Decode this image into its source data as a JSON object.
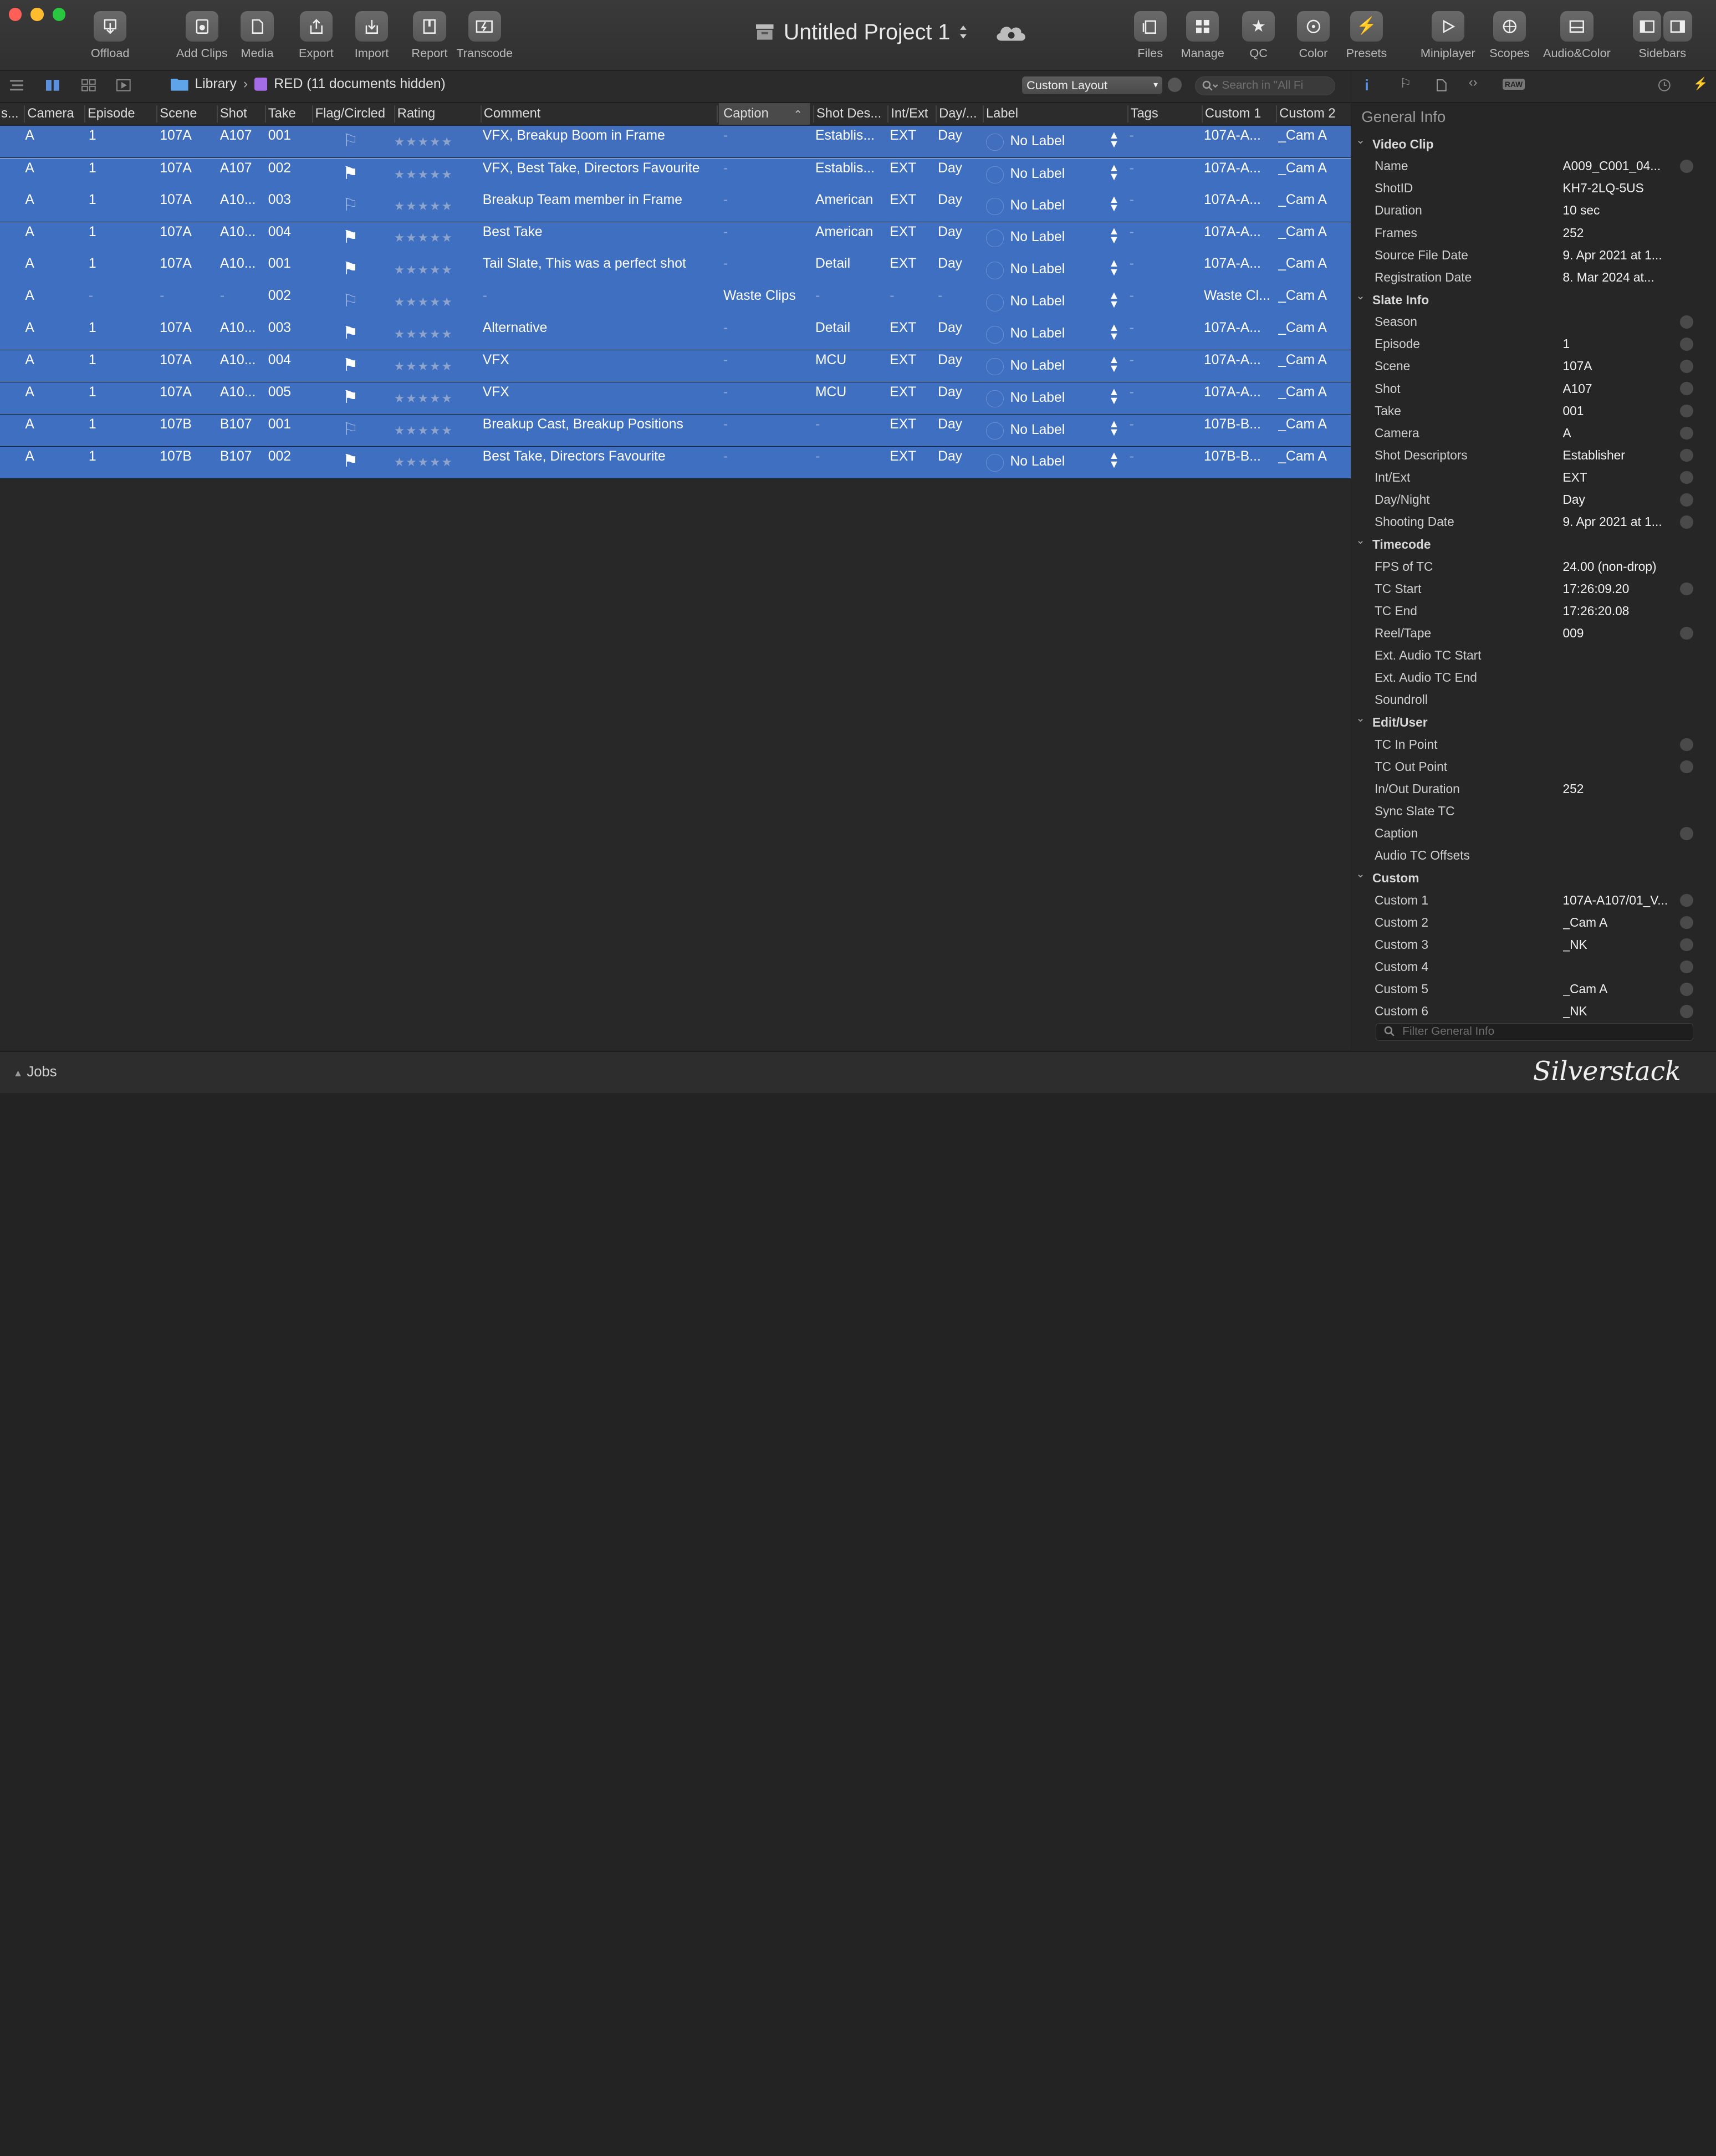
{
  "toolbar": {
    "buttons": [
      {
        "label": "Offload",
        "icon": "offload-icon"
      },
      {
        "label": "Add Clips",
        "icon": "add-clips-icon"
      },
      {
        "label": "Media",
        "icon": "media-icon"
      },
      {
        "label": "Export",
        "icon": "export-icon"
      },
      {
        "label": "Import",
        "icon": "import-icon"
      },
      {
        "label": "Report",
        "icon": "report-icon"
      },
      {
        "label": "Transcode",
        "icon": "transcode-icon"
      }
    ],
    "right_buttons": [
      {
        "label": "Files",
        "icon": "files-icon"
      },
      {
        "label": "Manage",
        "icon": "manage-icon"
      },
      {
        "label": "QC",
        "icon": "star-icon"
      },
      {
        "label": "Color",
        "icon": "color-icon"
      },
      {
        "label": "Presets",
        "icon": "bolt-icon"
      },
      {
        "label": "Miniplayer",
        "icon": "play-icon"
      },
      {
        "label": "Scopes",
        "icon": "scopes-icon"
      },
      {
        "label": "Audio&Color",
        "icon": "audio-color-icon"
      },
      {
        "label": "Sidebars",
        "icon": "sidebars-icon"
      }
    ],
    "project_title": "Untitled Project 1"
  },
  "subbar": {
    "breadcrumb_library": "Library",
    "breadcrumb_separator": "›",
    "breadcrumb_current": "RED (11 documents hidden)",
    "layout_select": "Custom Layout",
    "search_placeholder": "Search in \"All Fi"
  },
  "table": {
    "headers": [
      "s...",
      "Camera",
      "Episode",
      "Scene",
      "Shot",
      "Take",
      "Flag/Circled",
      "Rating",
      "Comment",
      "Caption",
      "Shot Des...",
      "Int/Ext",
      "Day/...",
      "Label",
      "Tags",
      "Custom 1",
      "Custom 2"
    ],
    "rows": [
      {
        "camera": "A",
        "episode": "1",
        "scene": "107A",
        "shot": "A107",
        "take": "001",
        "comment": "VFX, Breakup Boom in Frame",
        "caption": "-",
        "shotdesc": "Establis...",
        "intext": "EXT",
        "day": "Day",
        "label": "No Label",
        "tags": "-",
        "c1": "107A-A...",
        "c2": "_Cam A"
      },
      {
        "camera": "A",
        "episode": "1",
        "scene": "107A",
        "shot": "A107",
        "take": "002",
        "comment": "VFX, Best Take, Directors Favourite",
        "caption": "-",
        "shotdesc": "Establis...",
        "intext": "EXT",
        "day": "Day",
        "label": "No Label",
        "tags": "-",
        "c1": "107A-A...",
        "c2": "_Cam A"
      },
      {
        "camera": "A",
        "episode": "1",
        "scene": "107A",
        "shot": "A10...",
        "take": "003",
        "comment": "Breakup Team member in Frame",
        "caption": "-",
        "shotdesc": "American",
        "intext": "EXT",
        "day": "Day",
        "label": "No Label",
        "tags": "-",
        "c1": "107A-A...",
        "c2": "_Cam A"
      },
      {
        "camera": "A",
        "episode": "1",
        "scene": "107A",
        "shot": "A10...",
        "take": "004",
        "comment": "Best Take",
        "caption": "-",
        "shotdesc": "American",
        "intext": "EXT",
        "day": "Day",
        "label": "No Label",
        "tags": "-",
        "c1": "107A-A...",
        "c2": "_Cam A"
      },
      {
        "camera": "A",
        "episode": "1",
        "scene": "107A",
        "shot": "A10...",
        "take": "001",
        "comment": "Tail Slate, This was a perfect shot",
        "caption": "-",
        "shotdesc": "Detail",
        "intext": "EXT",
        "day": "Day",
        "label": "No Label",
        "tags": "-",
        "c1": "107A-A...",
        "c2": "_Cam A"
      },
      {
        "camera": "A",
        "episode": "-",
        "scene": "-",
        "shot": "-",
        "take": "002",
        "comment": "-",
        "caption": "Waste Clips",
        "shotdesc": "-",
        "intext": "-",
        "day": "-",
        "label": "No Label",
        "tags": "-",
        "c1": "Waste Cl...",
        "c2": "_Cam A"
      },
      {
        "camera": "A",
        "episode": "1",
        "scene": "107A",
        "shot": "A10...",
        "take": "003",
        "comment": "Alternative",
        "caption": "-",
        "shotdesc": "Detail",
        "intext": "EXT",
        "day": "Day",
        "label": "No Label",
        "tags": "-",
        "c1": "107A-A...",
        "c2": "_Cam A"
      },
      {
        "camera": "A",
        "episode": "1",
        "scene": "107A",
        "shot": "A10...",
        "take": "004",
        "comment": "VFX",
        "caption": "-",
        "shotdesc": "MCU",
        "intext": "EXT",
        "day": "Day",
        "label": "No Label",
        "tags": "-",
        "c1": "107A-A...",
        "c2": "_Cam A"
      },
      {
        "camera": "A",
        "episode": "1",
        "scene": "107A",
        "shot": "A10...",
        "take": "005",
        "comment": "VFX",
        "caption": "-",
        "shotdesc": "MCU",
        "intext": "EXT",
        "day": "Day",
        "label": "No Label",
        "tags": "-",
        "c1": "107A-A...",
        "c2": "_Cam A"
      },
      {
        "camera": "A",
        "episode": "1",
        "scene": "107B",
        "shot": "B107",
        "take": "001",
        "comment": "Breakup Cast, Breakup Positions",
        "caption": "-",
        "shotdesc": "-",
        "intext": "EXT",
        "day": "Day",
        "label": "No Label",
        "tags": "-",
        "c1": "107B-B...",
        "c2": "_Cam A"
      },
      {
        "camera": "A",
        "episode": "1",
        "scene": "107B",
        "shot": "B107",
        "take": "002",
        "comment": "Best Take, Directors Favourite",
        "caption": "-",
        "shotdesc": "-",
        "intext": "EXT",
        "day": "Day",
        "label": "No Label",
        "tags": "-",
        "c1": "107B-B...",
        "c2": "_Cam A"
      }
    ],
    "rating_stars": "★★★★★"
  },
  "inspector": {
    "title": "General Info",
    "sections": [
      {
        "name": "Video Clip",
        "items": [
          {
            "k": "Name",
            "v": "A009_C001_04...",
            "e": true
          },
          {
            "k": "ShotID",
            "v": "KH7-2LQ-5US",
            "e": false
          },
          {
            "k": "Duration",
            "v": "10 sec",
            "e": false
          },
          {
            "k": "Frames",
            "v": "252",
            "e": false
          },
          {
            "k": "Source File Date",
            "v": "9. Apr 2021 at 1...",
            "e": false
          },
          {
            "k": "Registration Date",
            "v": "8. Mar 2024 at...",
            "e": false
          }
        ]
      },
      {
        "name": "Slate Info",
        "items": [
          {
            "k": "Season",
            "v": "",
            "e": true
          },
          {
            "k": "Episode",
            "v": "1",
            "e": true
          },
          {
            "k": "Scene",
            "v": "107A",
            "e": true
          },
          {
            "k": "Shot",
            "v": "A107",
            "e": true
          },
          {
            "k": "Take",
            "v": "001",
            "e": true
          },
          {
            "k": "Camera",
            "v": "A",
            "e": true
          },
          {
            "k": "Shot Descriptors",
            "v": "Establisher",
            "e": true
          },
          {
            "k": "Int/Ext",
            "v": "EXT",
            "e": true
          },
          {
            "k": "Day/Night",
            "v": "Day",
            "e": true
          },
          {
            "k": "Shooting Date",
            "v": "9. Apr 2021 at 1...",
            "e": true
          }
        ]
      },
      {
        "name": "Timecode",
        "items": [
          {
            "k": "FPS of TC",
            "v": "24.00 (non-drop)",
            "e": false
          },
          {
            "k": "TC Start",
            "v": "17:26:09.20",
            "e": true
          },
          {
            "k": "TC End",
            "v": "17:26:20.08",
            "e": false
          },
          {
            "k": "Reel/Tape",
            "v": "009",
            "e": true
          },
          {
            "k": "Ext. Audio TC Start",
            "v": "",
            "e": false
          },
          {
            "k": "Ext. Audio TC End",
            "v": "",
            "e": false
          },
          {
            "k": "Soundroll",
            "v": "",
            "e": false
          }
        ]
      },
      {
        "name": "Edit/User",
        "items": [
          {
            "k": "TC In Point",
            "v": "",
            "e": true
          },
          {
            "k": "TC Out Point",
            "v": "",
            "e": true
          },
          {
            "k": "In/Out Duration",
            "v": "252",
            "e": false
          },
          {
            "k": "Sync Slate TC",
            "v": "",
            "e": false
          },
          {
            "k": "Caption",
            "v": "",
            "e": true
          },
          {
            "k": "Audio TC Offsets",
            "v": "",
            "e": false
          }
        ]
      },
      {
        "name": "Custom",
        "items": [
          {
            "k": "Custom 1",
            "v": "107A-A107/01_V...",
            "e": true
          },
          {
            "k": "Custom 2",
            "v": "_Cam A",
            "e": true
          },
          {
            "k": "Custom 3",
            "v": "_NK",
            "e": true
          },
          {
            "k": "Custom 4",
            "v": "",
            "e": true
          },
          {
            "k": "Custom 5",
            "v": "_Cam A",
            "e": true
          },
          {
            "k": "Custom 6",
            "v": "_NK",
            "e": true
          }
        ]
      }
    ],
    "filter_placeholder": "Filter General Info"
  },
  "status": {
    "jobs_label": "Jobs",
    "brand": "Silverstack"
  },
  "colors": {
    "selection": "#3e6fc1",
    "background": "#232323",
    "toolbar": "#353535"
  }
}
